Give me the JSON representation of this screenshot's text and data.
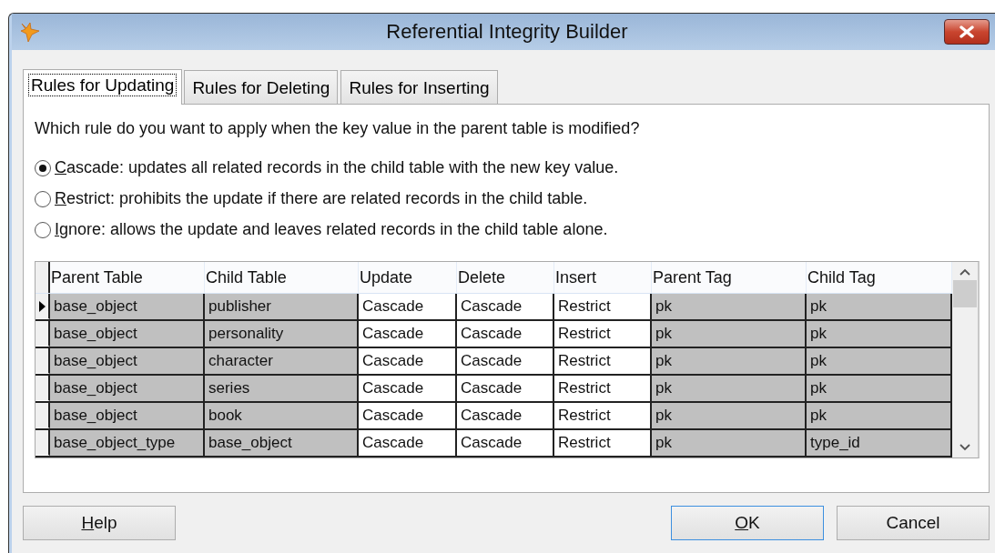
{
  "window": {
    "title": "Referential Integrity Builder"
  },
  "tabs": [
    {
      "label": "Rules for Updating",
      "selected": true
    },
    {
      "label": "Rules for Deleting",
      "selected": false
    },
    {
      "label": "Rules for Inserting",
      "selected": false
    }
  ],
  "question": "Which rule do you want to apply when the key value in the parent table is modified?",
  "options": [
    {
      "access_key": "C",
      "rest": "ascade: updates all related records in the child table with the new key value.",
      "selected": true
    },
    {
      "access_key": "R",
      "rest": "estrict: prohibits the update if there are related records in the child table.",
      "selected": false
    },
    {
      "access_key": "I",
      "rest": "gnore: allows the update and leaves related records in the child table alone.",
      "selected": false
    }
  ],
  "table": {
    "columns": [
      {
        "label": "Parent Table",
        "shaded": true
      },
      {
        "label": "Child Table",
        "shaded": true
      },
      {
        "label": "Update",
        "shaded": false
      },
      {
        "label": "Delete",
        "shaded": false
      },
      {
        "label": "Insert",
        "shaded": false
      },
      {
        "label": "Parent Tag",
        "shaded": true
      },
      {
        "label": "Child Tag",
        "shaded": true
      }
    ],
    "rows": [
      {
        "current": true,
        "cells": [
          "base_object",
          "publisher",
          "Cascade",
          "Cascade",
          "Restrict",
          "pk",
          "pk"
        ]
      },
      {
        "current": false,
        "cells": [
          "base_object",
          "personality",
          "Cascade",
          "Cascade",
          "Restrict",
          "pk",
          "pk"
        ]
      },
      {
        "current": false,
        "cells": [
          "base_object",
          "character",
          "Cascade",
          "Cascade",
          "Restrict",
          "pk",
          "pk"
        ]
      },
      {
        "current": false,
        "cells": [
          "base_object",
          "series",
          "Cascade",
          "Cascade",
          "Restrict",
          "pk",
          "pk"
        ]
      },
      {
        "current": false,
        "cells": [
          "base_object",
          "book",
          "Cascade",
          "Cascade",
          "Restrict",
          "pk",
          "pk"
        ]
      },
      {
        "current": false,
        "cells": [
          "base_object_type",
          "base_object",
          "Cascade",
          "Cascade",
          "Restrict",
          "pk",
          "type_id"
        ]
      }
    ]
  },
  "buttons": [
    {
      "access_key": "H",
      "rest": "elp",
      "default": false
    },
    {
      "access_key": "O",
      "rest": "K",
      "default": true
    },
    {
      "rest": "Cancel",
      "default": false
    }
  ]
}
